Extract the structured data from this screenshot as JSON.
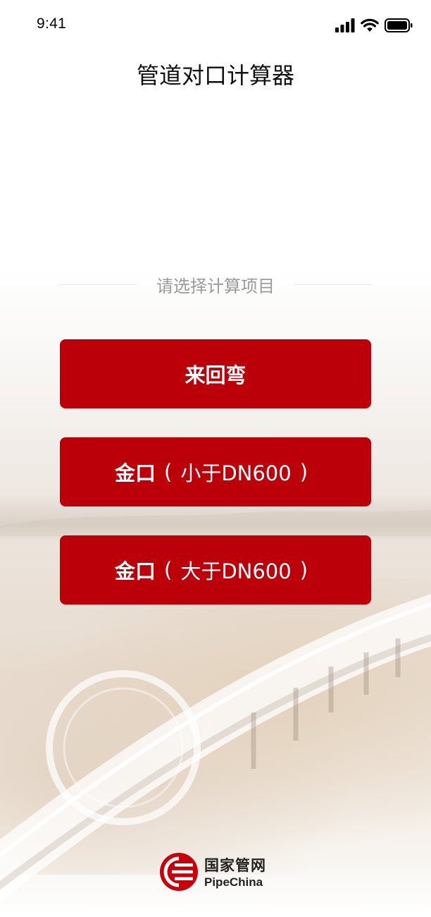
{
  "status_bar": {
    "time": "9:41",
    "icons": [
      "cellular-signal-icon",
      "wifi-icon",
      "battery-icon"
    ]
  },
  "header": {
    "title": "管道对口计算器"
  },
  "section": {
    "label": "请选择计算项目"
  },
  "buttons": [
    {
      "main": "来回弯",
      "paren_open": "",
      "detail": "",
      "paren_close": ""
    },
    {
      "main": "金口",
      "paren_open": "(",
      "detail": "小于DN600",
      "paren_close": ")"
    },
    {
      "main": "金口",
      "paren_open": "(",
      "detail": "大于DN600",
      "paren_close": ")"
    }
  ],
  "footer": {
    "logo_icon": "pipechina-logo-icon",
    "name_cn": "国家管网",
    "name_en": "PipeChina"
  },
  "colors": {
    "accent": "#bb0009",
    "button_text": "#ffffff",
    "section_label": "#9b9b9b",
    "divider": "#e7e7e7"
  }
}
